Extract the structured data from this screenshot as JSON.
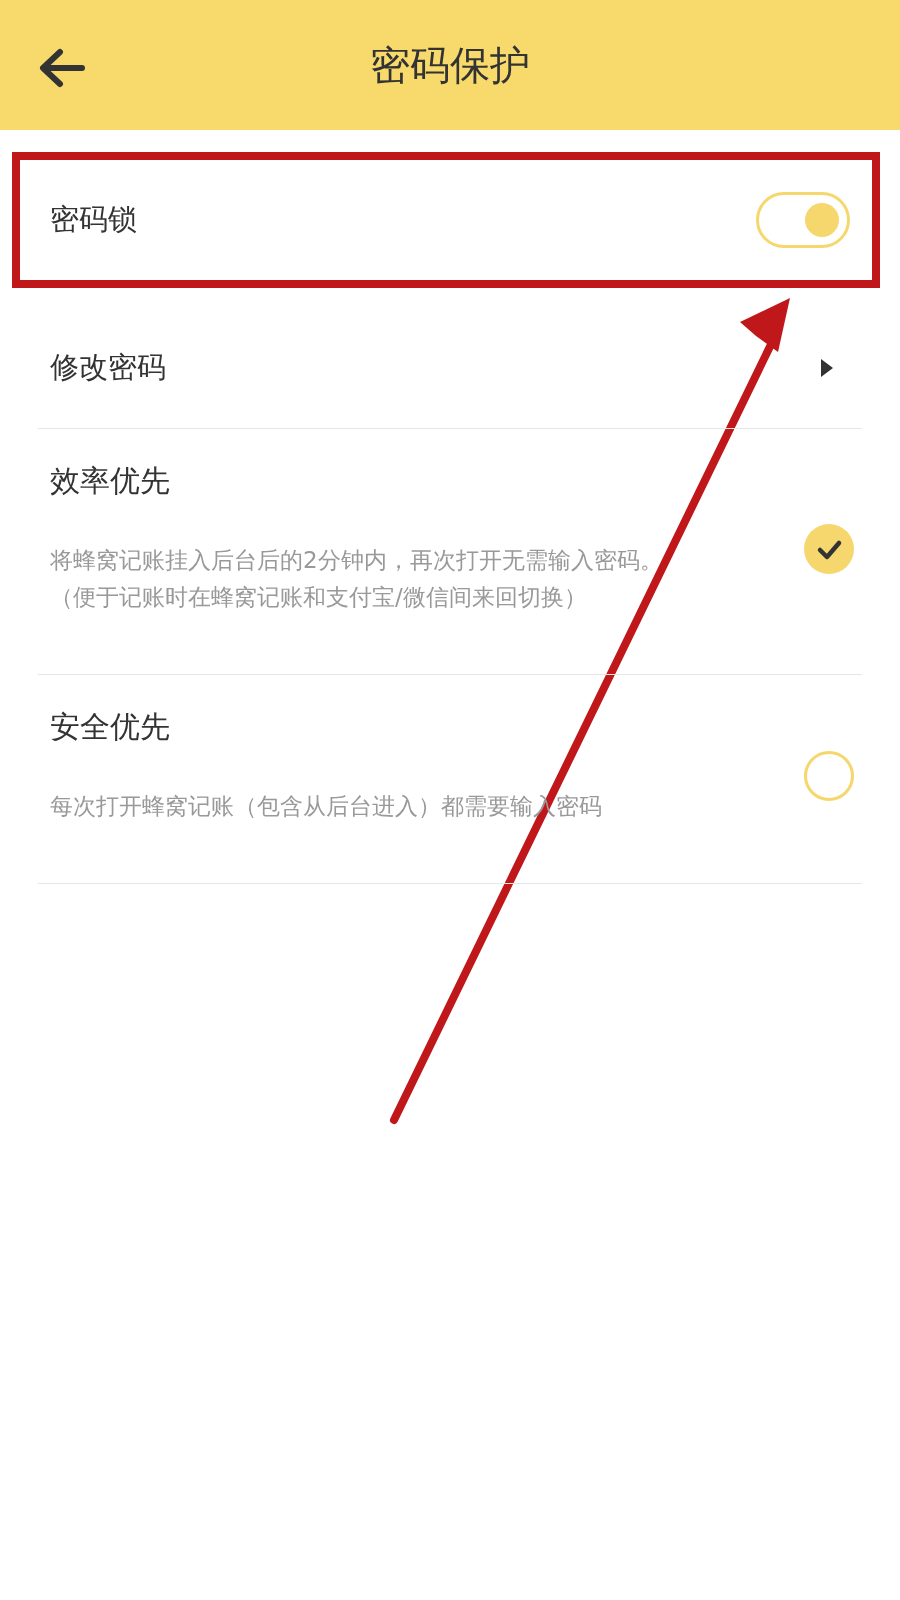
{
  "header": {
    "title": "密码保护"
  },
  "lock": {
    "label": "密码锁",
    "on": true
  },
  "change_password": {
    "label": "修改密码"
  },
  "modes": [
    {
      "title": "效率优先",
      "description": [
        "将蜂窝记账挂入后台后的2分钟内，再次打开无需输入密码。",
        "（便于记账时在蜂窝记账和支付宝/微信间来回切换）"
      ],
      "selected": true
    },
    {
      "title": "安全优先",
      "description": [
        "每次打开蜂窝记账（包含从后台进入）都需要输入密码"
      ],
      "selected": false
    }
  ]
}
